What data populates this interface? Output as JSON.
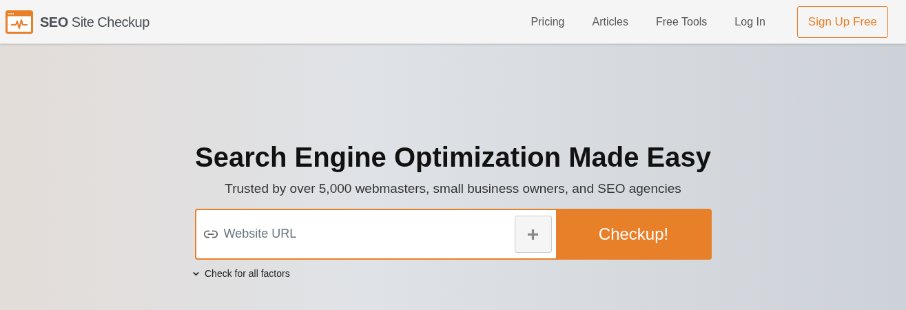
{
  "header": {
    "logo_text": "**SEO** Site Checkup",
    "nav": [
      "Pricing",
      "Articles",
      "Free Tools",
      "Log In"
    ],
    "signup_button": "Sign Up Free"
  },
  "hero": {
    "title": "Search Engine Optimization Made Easy",
    "subtitle": "Trusted by over 5,000 webmasters, small business owners, and SEO agencies",
    "url_field": {
      "placeholder": "Website URL"
    },
    "add_button": "+",
    "checkup_button": "Checkup!",
    "options_toggle": {
      "label": "Check for all factors",
      "expanded": false
    }
  }
}
